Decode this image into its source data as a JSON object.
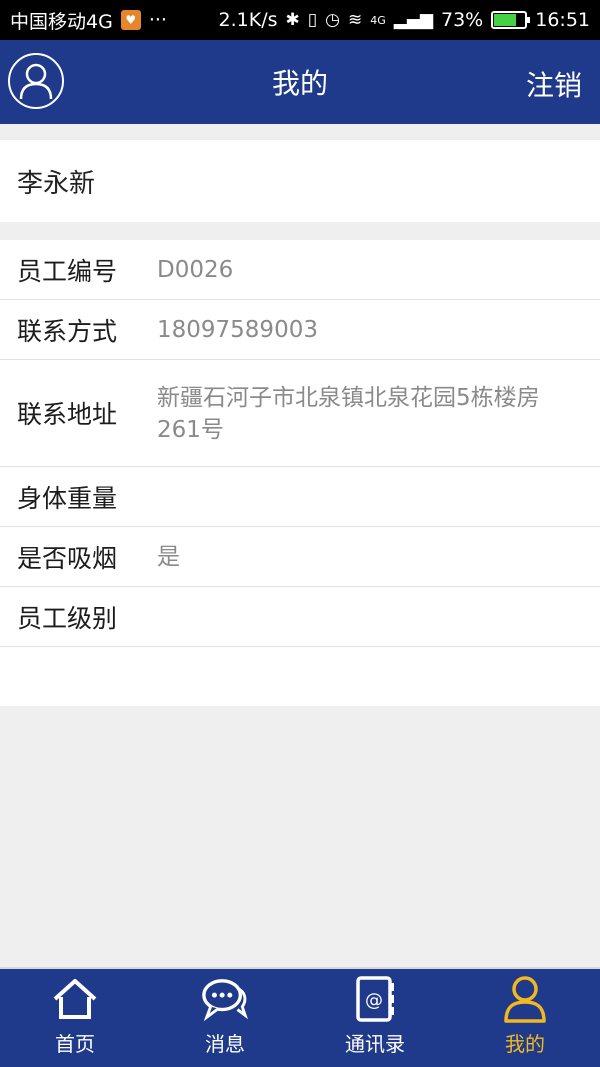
{
  "status_bar": {
    "carrier": "中国移动4G",
    "dots": "···",
    "speed": "2.1K/s",
    "net": "4G",
    "battery": "73%",
    "battery_level": 0.73,
    "time": "16:51"
  },
  "header": {
    "title": "我的",
    "logout_label": "注销",
    "avatar_icon": "user-avatar-icon"
  },
  "profile": {
    "name": "李永新"
  },
  "info": [
    {
      "label": "员工编号",
      "value": "D0026"
    },
    {
      "label": "联系方式",
      "value": "18097589003"
    },
    {
      "label": "联系地址",
      "value": "新疆石河子市北泉镇北泉花园5栋楼房261号"
    },
    {
      "label": "身体重量",
      "value": ""
    },
    {
      "label": "是否吸烟",
      "value": "是"
    },
    {
      "label": "员工级别",
      "value": ""
    }
  ],
  "nav": [
    {
      "label": "首页",
      "icon": "home-icon"
    },
    {
      "label": "消息",
      "icon": "chat-icon"
    },
    {
      "label": "通讯录",
      "icon": "contacts-icon"
    },
    {
      "label": "我的",
      "icon": "user-icon",
      "active": true
    }
  ],
  "colors": {
    "header_bg": "#1f3a8a",
    "active_tab": "#f3b81e"
  }
}
